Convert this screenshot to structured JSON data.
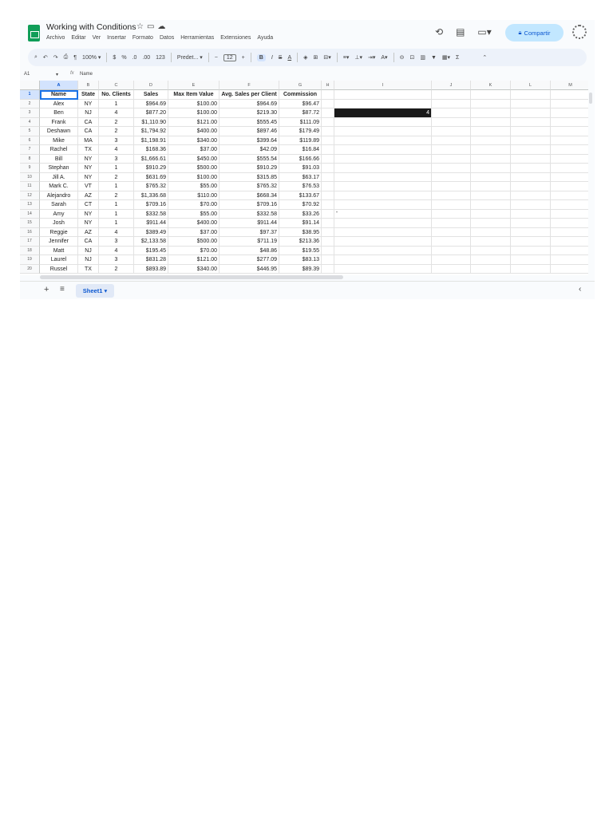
{
  "doc": {
    "title": "Working with Conditions",
    "menus": [
      "Archivo",
      "Editar",
      "Ver",
      "Insertar",
      "Formato",
      "Datos",
      "Herramientas",
      "Extensiones",
      "Ayuda"
    ],
    "share_label": "Compartir"
  },
  "toolbar": {
    "zoom": "100%",
    "currency": "$",
    "percent": "%",
    "dec_less": ".0",
    "dec_more": ".00",
    "num_format": "123",
    "font": "Predet...",
    "font_size": "12",
    "bold": "B",
    "italic": "I",
    "strike": "S",
    "text_color": "A"
  },
  "formula_bar": {
    "cell_ref": "A1",
    "fx": "fx",
    "content": "Name"
  },
  "grid": {
    "columns": [
      "A",
      "B",
      "C",
      "D",
      "E",
      "F",
      "G",
      "H",
      "I",
      "J",
      "K",
      "L",
      "M"
    ],
    "row_numbers": [
      "1",
      "2",
      "3",
      "4",
      "5",
      "6",
      "7",
      "8",
      "9",
      "10",
      "11",
      "12",
      "13",
      "14",
      "15",
      "16",
      "17",
      "18",
      "19",
      "20"
    ],
    "headers": [
      "Name",
      "State",
      "No. Clients",
      "Sales",
      "Max Item Value",
      "Avg. Sales per Client",
      "Commission"
    ],
    "rows": [
      [
        "Alex",
        "NY",
        "1",
        "$964.69",
        "$100.00",
        "$964.69",
        "$96.47"
      ],
      [
        "Ben",
        "NJ",
        "4",
        "$877.20",
        "$100.00",
        "$219.30",
        "$87.72"
      ],
      [
        "Frank",
        "CA",
        "2",
        "$1,110.90",
        "$121.00",
        "$555.45",
        "$111.09"
      ],
      [
        "Deshawn",
        "CA",
        "2",
        "$1,794.92",
        "$400.00",
        "$897.46",
        "$179.49"
      ],
      [
        "Mike",
        "MA",
        "3",
        "$1,198.91",
        "$340.00",
        "$399.64",
        "$119.89"
      ],
      [
        "Rachel",
        "TX",
        "4",
        "$168.36",
        "$37.00",
        "$42.09",
        "$16.84"
      ],
      [
        "Bill",
        "NY",
        "3",
        "$1,666.61",
        "$450.00",
        "$555.54",
        "$166.66"
      ],
      [
        "Stephan",
        "NY",
        "1",
        "$910.29",
        "$500.00",
        "$910.29",
        "$91.03"
      ],
      [
        "Jill A.",
        "NY",
        "2",
        "$631.69",
        "$100.00",
        "$315.85",
        "$63.17"
      ],
      [
        "Mark C.",
        "VT",
        "1",
        "$765.32",
        "$55.00",
        "$765.32",
        "$76.53"
      ],
      [
        "Alejandro",
        "AZ",
        "2",
        "$1,336.68",
        "$110.00",
        "$668.34",
        "$133.67"
      ],
      [
        "Sarah",
        "CT",
        "1",
        "$709.16",
        "$70.00",
        "$709.16",
        "$70.92"
      ],
      [
        "Amy",
        "NY",
        "1",
        "$332.58",
        "$55.00",
        "$332.58",
        "$33.26"
      ],
      [
        "Josh",
        "NY",
        "1",
        "$911.44",
        "$400.00",
        "$911.44",
        "$91.14"
      ],
      [
        "Reggie",
        "AZ",
        "4",
        "$389.49",
        "$37.00",
        "$97.37",
        "$38.95"
      ],
      [
        "Jennifer",
        "CA",
        "3",
        "$2,133.58",
        "$500.00",
        "$711.19",
        "$213.36"
      ],
      [
        "Matt",
        "NJ",
        "4",
        "$195.45",
        "$70.00",
        "$48.86",
        "$19.55"
      ],
      [
        "Laurel",
        "NJ",
        "3",
        "$831.28",
        "$121.00",
        "$277.09",
        "$83.13"
      ],
      [
        "Russel",
        "TX",
        "2",
        "$893.89",
        "$340.00",
        "$446.95",
        "$89.39"
      ]
    ],
    "cell_I3": "4",
    "cell_I14": "\""
  },
  "sheets": {
    "active": "Sheet1"
  },
  "colors": {
    "accent": "#0b57d0",
    "sheets_green": "#0f9d58",
    "selection": "#1a73e8",
    "dark_cell": "#1a1a1a"
  }
}
